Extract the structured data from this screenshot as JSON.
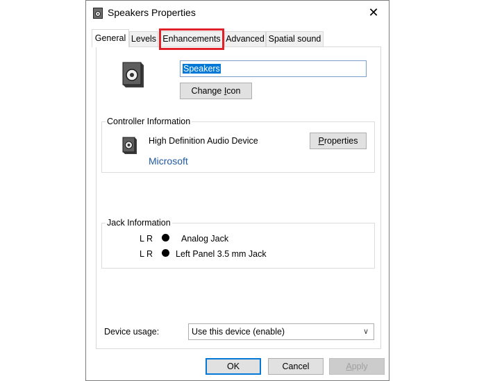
{
  "window": {
    "title": "Speakers Properties",
    "close_glyph": "✕"
  },
  "tabs": [
    {
      "label": "General",
      "active": true
    },
    {
      "label": "Levels",
      "active": false
    },
    {
      "label": "Enhancements",
      "active": false,
      "highlighted": true
    },
    {
      "label": "Advanced",
      "active": false
    },
    {
      "label": "Spatial sound",
      "active": false
    }
  ],
  "general": {
    "device_name": "Speakers",
    "change_icon_pre": "Change ",
    "change_icon_accel": "I",
    "change_icon_post": "con"
  },
  "controller": {
    "group_label": "Controller Information",
    "device": "High Definition Audio Device",
    "vendor": "Microsoft",
    "properties_accel": "P",
    "properties_rest": "roperties"
  },
  "jack": {
    "group_label": "Jack Information",
    "rows": [
      {
        "lr": "L R",
        "label": "Analog Jack"
      },
      {
        "lr": "L R",
        "label": "Left Panel 3.5 mm Jack"
      }
    ]
  },
  "device_usage": {
    "label": "Device usage:",
    "value": "Use this device (enable)"
  },
  "footer": {
    "ok": "OK",
    "cancel": "Cancel",
    "apply_accel": "A",
    "apply_rest": "pply"
  },
  "colors": {
    "highlight_border": "#e0212a",
    "selection": "#0078d7",
    "link": "#1e5aa0"
  }
}
